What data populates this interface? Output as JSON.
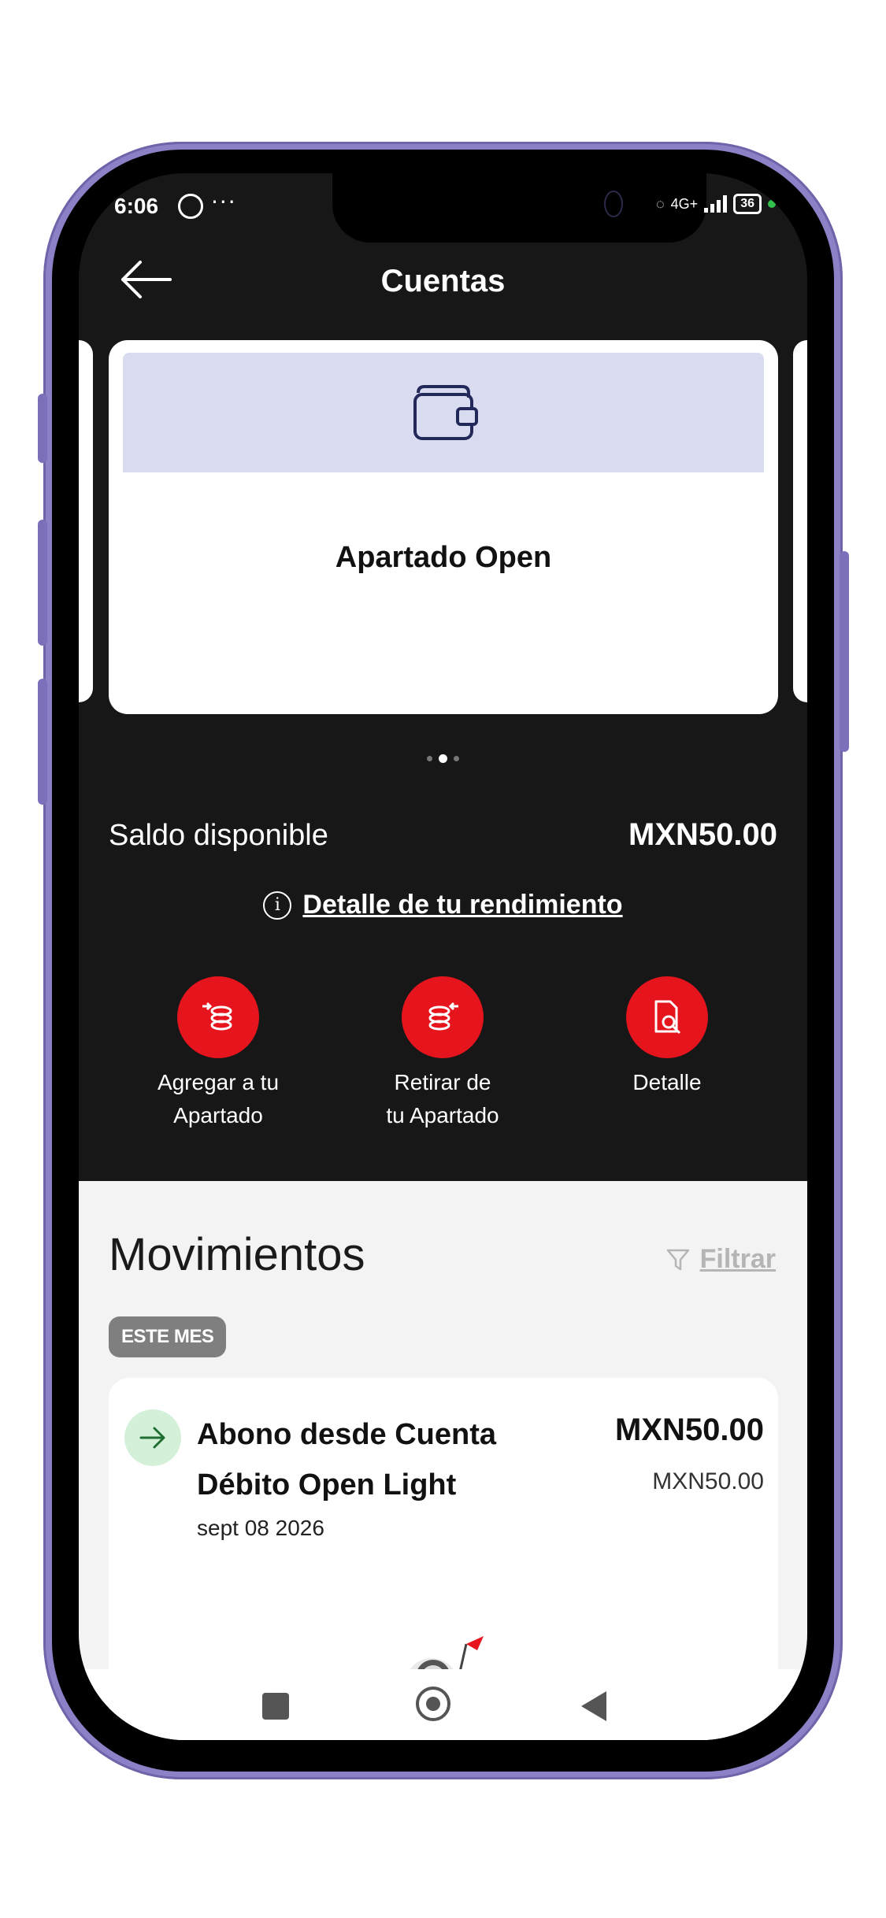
{
  "status_bar": {
    "time": "6:06",
    "dots": "···",
    "network": "4G+",
    "battery": "36"
  },
  "header": {
    "title": "Cuentas",
    "back_icon": "arrow-left-icon"
  },
  "carousel": {
    "card_name": "Apartado Open",
    "card_icon": "wallet-icon",
    "page_count": 3,
    "active_page": 2
  },
  "balance": {
    "label": "Saldo disponible",
    "value": "MXN50.00"
  },
  "performance_link": {
    "icon": "info-icon",
    "label": "Detalle de tu rendimiento"
  },
  "actions": [
    {
      "label_line1": "Agregar a tu",
      "label_line2": "Apartado",
      "icon": "add-coins-icon"
    },
    {
      "label_line1": "Retirar de",
      "label_line2": "tu Apartado",
      "icon": "withdraw-coins-icon"
    },
    {
      "label_line1": "Detalle",
      "label_line2": "",
      "icon": "document-search-icon"
    }
  ],
  "movements": {
    "title": "Movimientos",
    "filter_label": "Filtrar",
    "filter_icon": "funnel-icon",
    "period_badge": "ESTE MES",
    "items": [
      {
        "description_line1": "Abono desde Cuenta",
        "description_line2": "Débito Open Light",
        "date": "sept 08 2026",
        "amount": "MXN50.00",
        "amount_secondary": "MXN50.00",
        "icon": "arrow-right-icon"
      }
    ]
  },
  "colors": {
    "accent_red": "#e5141d",
    "dark_bg": "#171717",
    "card_header": "#d9dcf0",
    "credit_green": "#d4f0d8"
  }
}
